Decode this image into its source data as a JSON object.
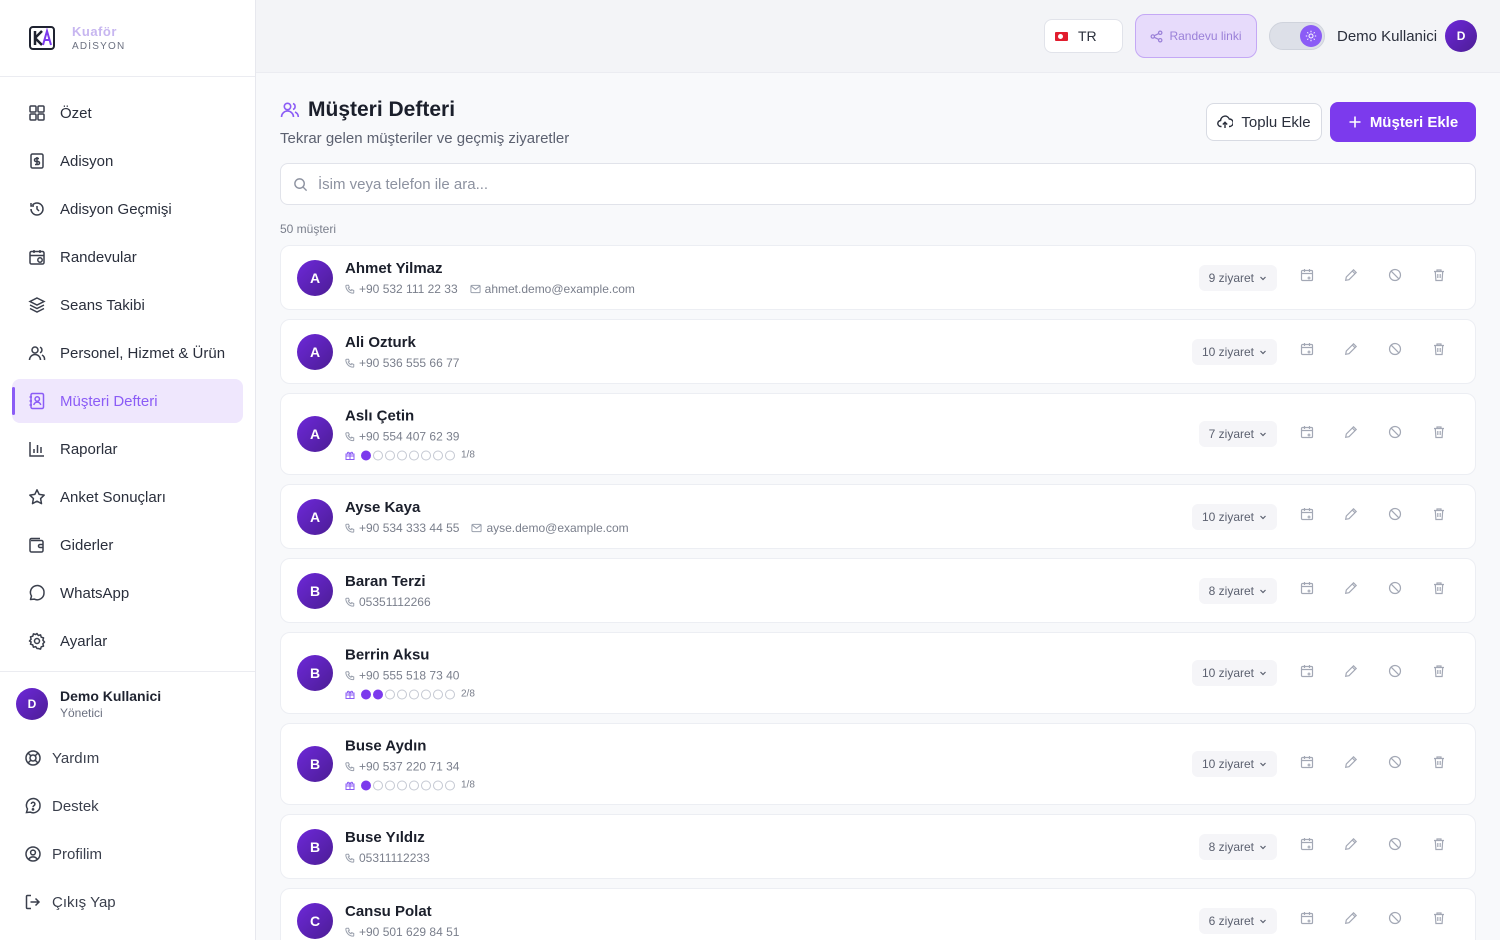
{
  "brand": {
    "name": "Kuaför",
    "sub": "ADİSYON"
  },
  "sidebar": {
    "items": [
      {
        "label": "Özet",
        "icon": "grid-icon"
      },
      {
        "label": "Adisyon",
        "icon": "receipt-icon"
      },
      {
        "label": "Adisyon Geçmişi",
        "icon": "history-icon"
      },
      {
        "label": "Randevular",
        "icon": "calendar-icon"
      },
      {
        "label": "Seans Takibi",
        "icon": "layers-icon"
      },
      {
        "label": "Personel, Hizmet & Ürün",
        "icon": "users-icon"
      },
      {
        "label": "Müşteri Defteri",
        "icon": "contact-book-icon",
        "active": true
      },
      {
        "label": "Raporlar",
        "icon": "bar-chart-icon"
      },
      {
        "label": "Anket Sonuçları",
        "icon": "star-icon"
      },
      {
        "label": "Giderler",
        "icon": "wallet-icon"
      },
      {
        "label": "WhatsApp",
        "icon": "chat-bubble-icon"
      },
      {
        "label": "Ayarlar",
        "icon": "gear-icon"
      }
    ],
    "user": {
      "initial": "D",
      "name": "Demo Kullanici",
      "role": "Yönetici"
    },
    "links": [
      {
        "label": "Yardım",
        "icon": "lifebuoy-icon"
      },
      {
        "label": "Destek",
        "icon": "help-circle-icon"
      },
      {
        "label": "Profilim",
        "icon": "user-circle-icon"
      },
      {
        "label": "Çıkış Yap",
        "icon": "logout-icon"
      }
    ]
  },
  "topbar": {
    "lang": "TR",
    "appointment_link": "Randevu linki",
    "user_name": "Demo Kullanici",
    "user_initial": "D"
  },
  "page": {
    "title": "Müşteri Defteri",
    "subtitle": "Tekrar gelen müşteriler ve geçmiş ziyaretler",
    "bulk_add": "Toplu Ekle",
    "add_customer": "Müşteri Ekle",
    "search_placeholder": "İsim veya telefon ile ara...",
    "count_label": "50 müşteri"
  },
  "colors": {
    "accent": "#7c3aed",
    "active_bg": "#efe7fd"
  },
  "customers": [
    {
      "initial": "A",
      "name": "Ahmet Yilmaz",
      "phone": "+90 532 111 22 33",
      "email": "ahmet.demo@example.com",
      "visits": "9 ziyaret"
    },
    {
      "initial": "A",
      "name": "Ali Ozturk",
      "phone": "+90 536 555 66 77",
      "visits": "10 ziyaret"
    },
    {
      "initial": "A",
      "name": "Aslı Çetin",
      "phone": "+90 554 407 62 39",
      "visits": "7 ziyaret",
      "loyalty": {
        "filled": 1,
        "total": 8,
        "label": "1/8"
      }
    },
    {
      "initial": "A",
      "name": "Ayse Kaya",
      "phone": "+90 534 333 44 55",
      "email": "ayse.demo@example.com",
      "visits": "10 ziyaret"
    },
    {
      "initial": "B",
      "name": "Baran Terzi",
      "phone": "05351112266",
      "visits": "8 ziyaret"
    },
    {
      "initial": "B",
      "name": "Berrin Aksu",
      "phone": "+90 555 518 73 40",
      "visits": "10 ziyaret",
      "loyalty": {
        "filled": 2,
        "total": 8,
        "label": "2/8"
      }
    },
    {
      "initial": "B",
      "name": "Buse Aydın",
      "phone": "+90 537 220 71 34",
      "visits": "10 ziyaret",
      "loyalty": {
        "filled": 1,
        "total": 8,
        "label": "1/8"
      }
    },
    {
      "initial": "B",
      "name": "Buse Yıldız",
      "phone": "05311112233",
      "visits": "8 ziyaret"
    },
    {
      "initial": "C",
      "name": "Cansu Polat",
      "phone": "+90 501 629 84 51",
      "visits": "6 ziyaret"
    }
  ]
}
